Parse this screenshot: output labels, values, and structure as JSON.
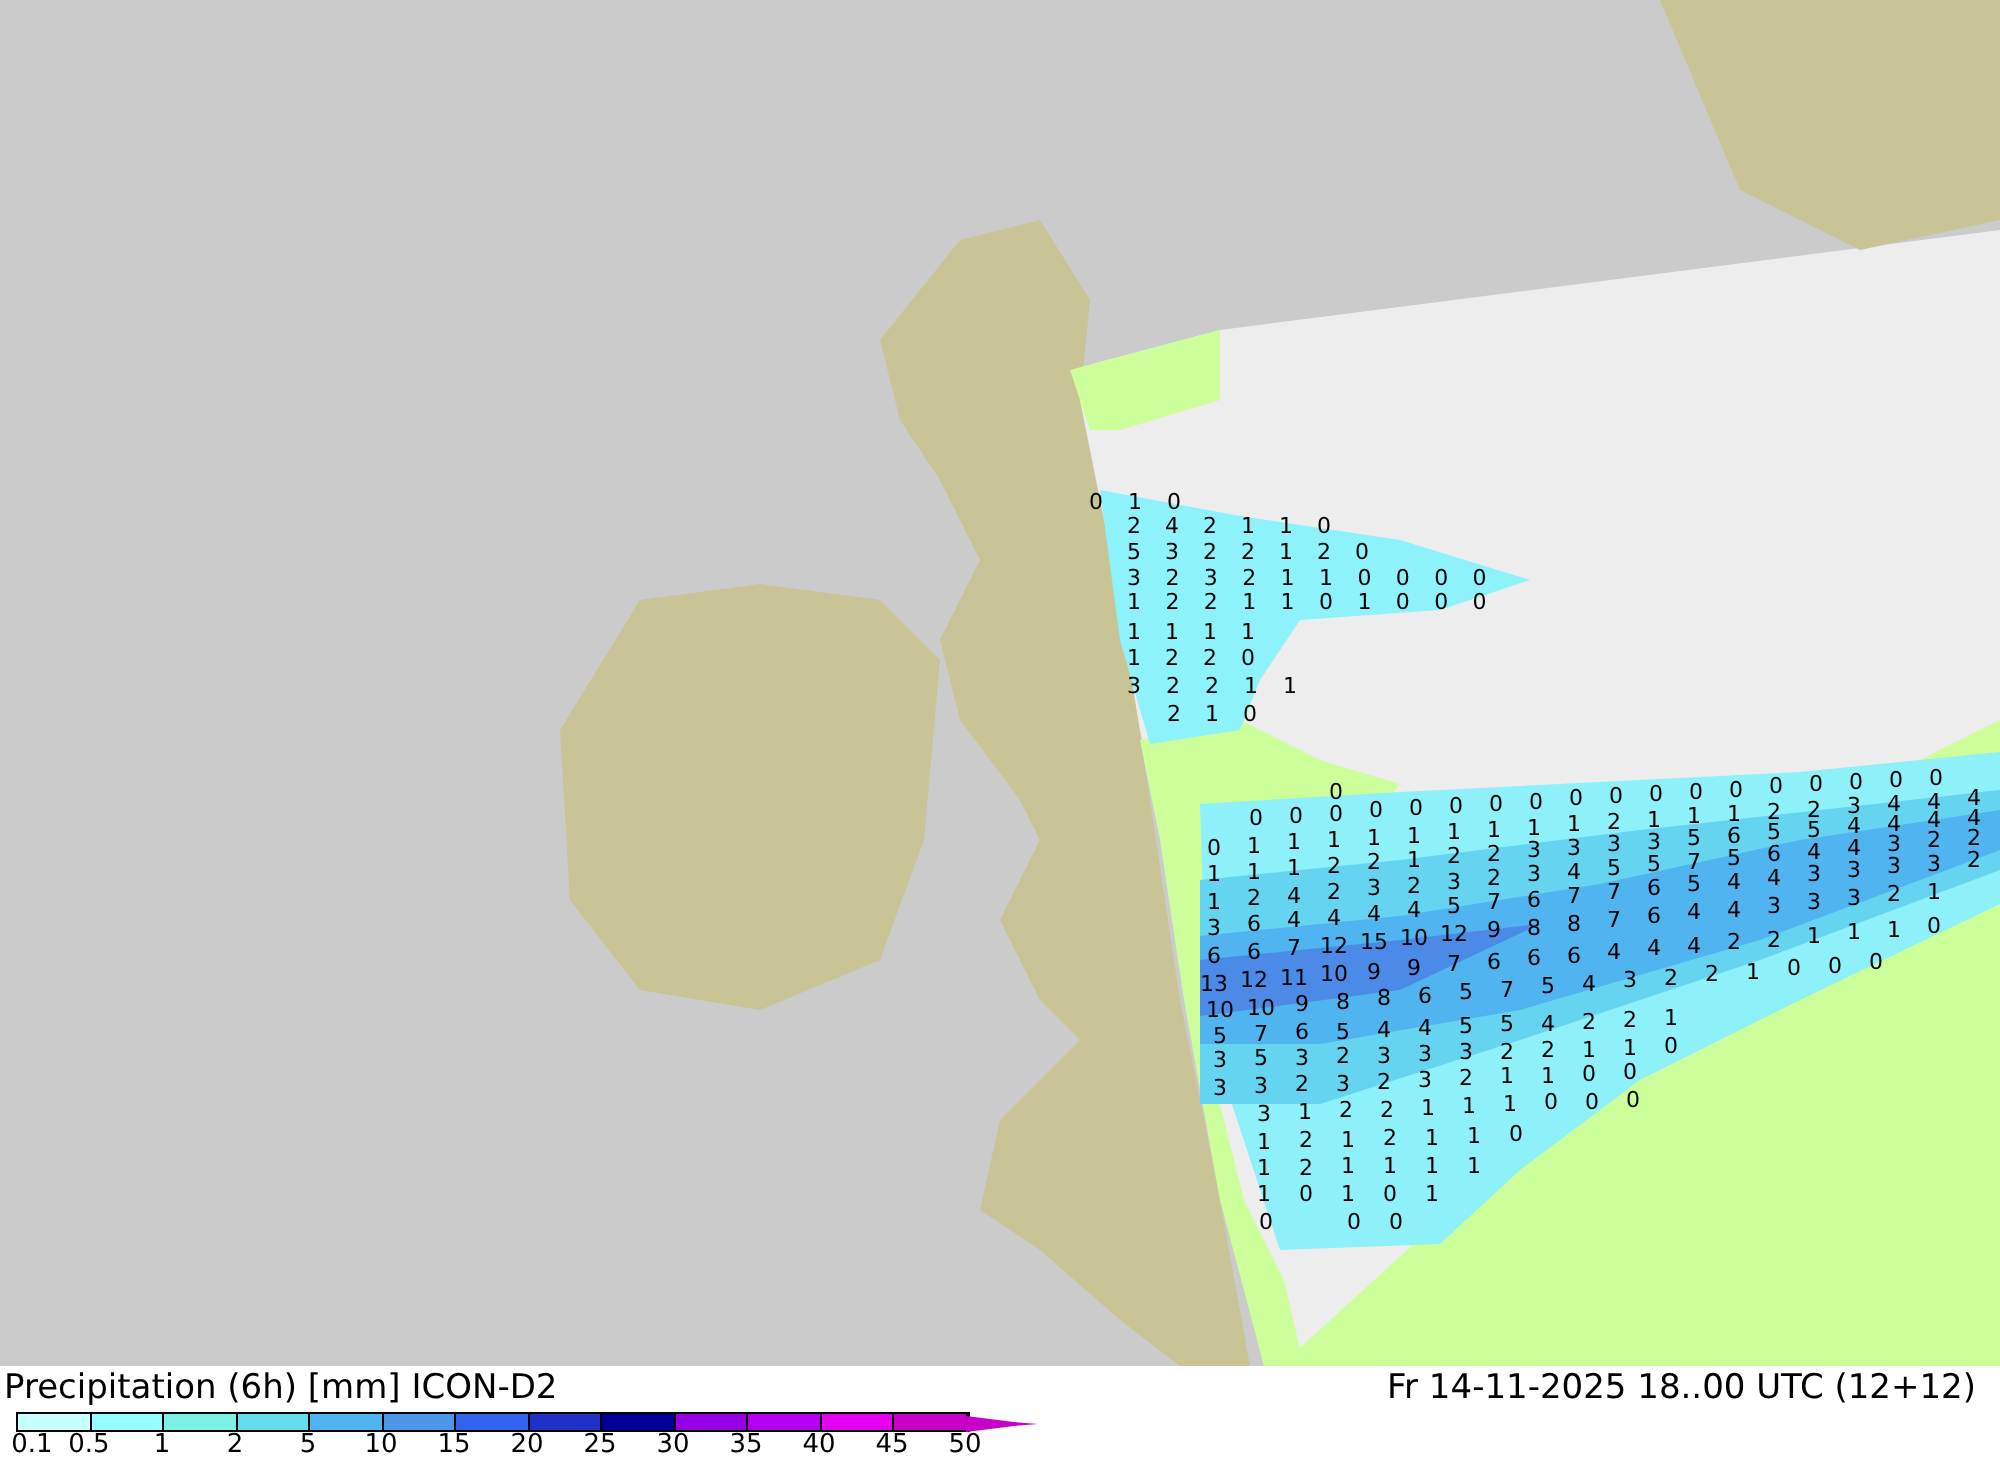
{
  "map": {
    "precipitation_values": [
      {
        "values": [
          "0",
          "1",
          "0"
        ]
      },
      {
        "values": [
          "2",
          "4",
          "2",
          "1",
          "1",
          "0"
        ]
      },
      {
        "values": [
          "5",
          "3",
          "2",
          "2",
          "1",
          "2",
          "0"
        ]
      },
      {
        "values": [
          "3",
          "2",
          "3",
          "2",
          "1",
          "1",
          "0",
          "0",
          "0",
          "0"
        ]
      },
      {
        "values": [
          "1",
          "2",
          "2",
          "1",
          "1",
          "0",
          "1",
          "0",
          "0",
          "0"
        ]
      },
      {
        "values": [
          "1",
          "1",
          "1",
          "1"
        ]
      },
      {
        "values": [
          "1",
          "2",
          "2",
          "0"
        ]
      },
      {
        "values": [
          "3",
          "2",
          "2",
          "1",
          "1"
        ]
      },
      {
        "values": [
          "2",
          "1",
          "0"
        ]
      },
      {
        "values": [
          "0"
        ]
      },
      {
        "values": [
          "0",
          "0",
          "0",
          "0",
          "0",
          "0",
          "0",
          "0",
          "0",
          "0",
          "0",
          "0",
          "0",
          "0",
          "0",
          "0",
          "0",
          "0"
        ]
      },
      {
        "values": [
          "0",
          "1",
          "1",
          "1",
          "1",
          "1",
          "1",
          "1",
          "1",
          "1",
          "2",
          "1",
          "1",
          "1",
          "2",
          "2",
          "3",
          "4",
          "4",
          "4"
        ]
      },
      {
        "values": [
          "1",
          "1",
          "1",
          "2",
          "2",
          "1",
          "2",
          "2",
          "3",
          "3",
          "3",
          "3",
          "5",
          "6",
          "5",
          "5",
          "4",
          "4",
          "4",
          "4"
        ]
      },
      {
        "values": [
          "1",
          "2",
          "4",
          "2",
          "3",
          "2",
          "3",
          "2",
          "3",
          "4",
          "5",
          "5",
          "7",
          "5",
          "6",
          "4",
          "4",
          "3",
          "2",
          "2"
        ]
      },
      {
        "values": [
          "3",
          "6",
          "4",
          "4",
          "4",
          "4",
          "5",
          "7",
          "6",
          "7",
          "7",
          "6",
          "5",
          "4",
          "4",
          "3",
          "3",
          "3",
          "3",
          "2"
        ]
      },
      {
        "values": [
          "6",
          "6",
          "7",
          "12",
          "15",
          "10",
          "12",
          "9",
          "8",
          "8",
          "7",
          "6",
          "4",
          "4",
          "3",
          "3",
          "3",
          "2",
          "1"
        ]
      },
      {
        "values": [
          "13",
          "12",
          "11",
          "10",
          "9",
          "9",
          "7",
          "6",
          "6",
          "6",
          "4",
          "4",
          "4",
          "2",
          "2",
          "1",
          "1",
          "1",
          "0"
        ]
      },
      {
        "values": [
          "10",
          "10",
          "9",
          "8",
          "8",
          "6",
          "5",
          "7",
          "5",
          "4",
          "3",
          "2",
          "2",
          "1",
          "0",
          "0",
          "0"
        ]
      },
      {
        "values": [
          "5",
          "7",
          "6",
          "5",
          "4",
          "4",
          "5",
          "5",
          "4",
          "2",
          "2",
          "1"
        ]
      },
      {
        "values": [
          "3",
          "5",
          "3",
          "2",
          "3",
          "3",
          "3",
          "2",
          "2",
          "1",
          "1",
          "0"
        ]
      },
      {
        "values": [
          "3",
          "3",
          "2",
          "3",
          "2",
          "3",
          "2",
          "1",
          "1",
          "0",
          "0"
        ]
      },
      {
        "values": [
          "3",
          "1",
          "2",
          "2",
          "1",
          "1",
          "1",
          "0",
          "0",
          "0"
        ]
      },
      {
        "values": [
          "1",
          "2",
          "1",
          "2",
          "1",
          "1",
          "0"
        ]
      },
      {
        "values": [
          "1",
          "2",
          "1",
          "1",
          "1",
          "1"
        ]
      },
      {
        "values": [
          "1",
          "0",
          "1",
          "0",
          "1"
        ]
      },
      {
        "values": [
          "0"
        ]
      },
      {
        "values": [
          "0",
          "0"
        ]
      }
    ]
  },
  "footer": {
    "title": "Precipitation (6h) [mm] ICON-D2",
    "valid_time": "Fr 14-11-2025 18..00 UTC (12+12)",
    "legend": {
      "boxes": [
        {
          "color": "#c8ffff"
        },
        {
          "color": "#96ffff"
        },
        {
          "color": "#7df0e6"
        },
        {
          "color": "#64dcf0"
        },
        {
          "color": "#50b4f0"
        },
        {
          "color": "#4b96e6"
        },
        {
          "color": "#3264f0"
        },
        {
          "color": "#1e32c8"
        },
        {
          "color": "#000096"
        },
        {
          "color": "#9600e6"
        },
        {
          "color": "#b400f0"
        },
        {
          "color": "#e600f0"
        },
        {
          "color": "#c800c8"
        }
      ],
      "ticks": [
        "0.1",
        "0.5",
        "1",
        "2",
        "5",
        "10",
        "15",
        "20",
        "25",
        "30",
        "35",
        "40",
        "45",
        "50"
      ]
    }
  }
}
